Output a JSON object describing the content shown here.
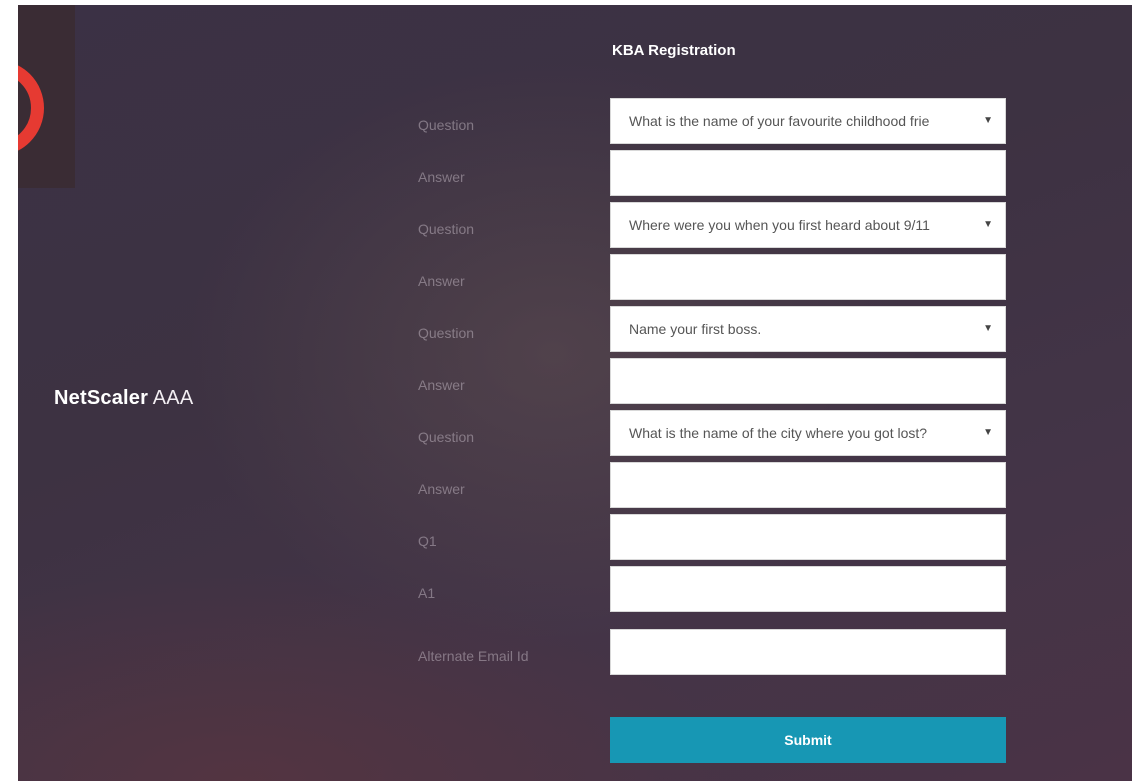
{
  "brand": {
    "bold": "NetScaler",
    "light": "AAA"
  },
  "form": {
    "title": "KBA Registration",
    "rows": [
      {
        "label": "Question",
        "kind": "select",
        "value": "What is the name of your favourite childhood frie"
      },
      {
        "label": "Answer",
        "kind": "input",
        "value": ""
      },
      {
        "label": "Question",
        "kind": "select",
        "value": "Where were you when you first heard about 9/11"
      },
      {
        "label": "Answer",
        "kind": "input",
        "value": ""
      },
      {
        "label": "Question",
        "kind": "select",
        "value": "Name your first boss."
      },
      {
        "label": "Answer",
        "kind": "input",
        "value": ""
      },
      {
        "label": "Question",
        "kind": "select",
        "value": "What is the name of the city where you got lost?"
      },
      {
        "label": "Answer",
        "kind": "input",
        "value": ""
      },
      {
        "label": "Q1",
        "kind": "input",
        "value": ""
      },
      {
        "label": "A1",
        "kind": "input",
        "value": ""
      },
      {
        "label": "Alternate Email Id",
        "kind": "input",
        "value": ""
      }
    ],
    "caret": "▼",
    "submit_label": "Submit"
  },
  "colors": {
    "accent": "#1797b4",
    "background": "#3d3242",
    "overlay_ring": "#e63a32"
  },
  "icons": {
    "dropdown": "chevron-down-icon"
  }
}
